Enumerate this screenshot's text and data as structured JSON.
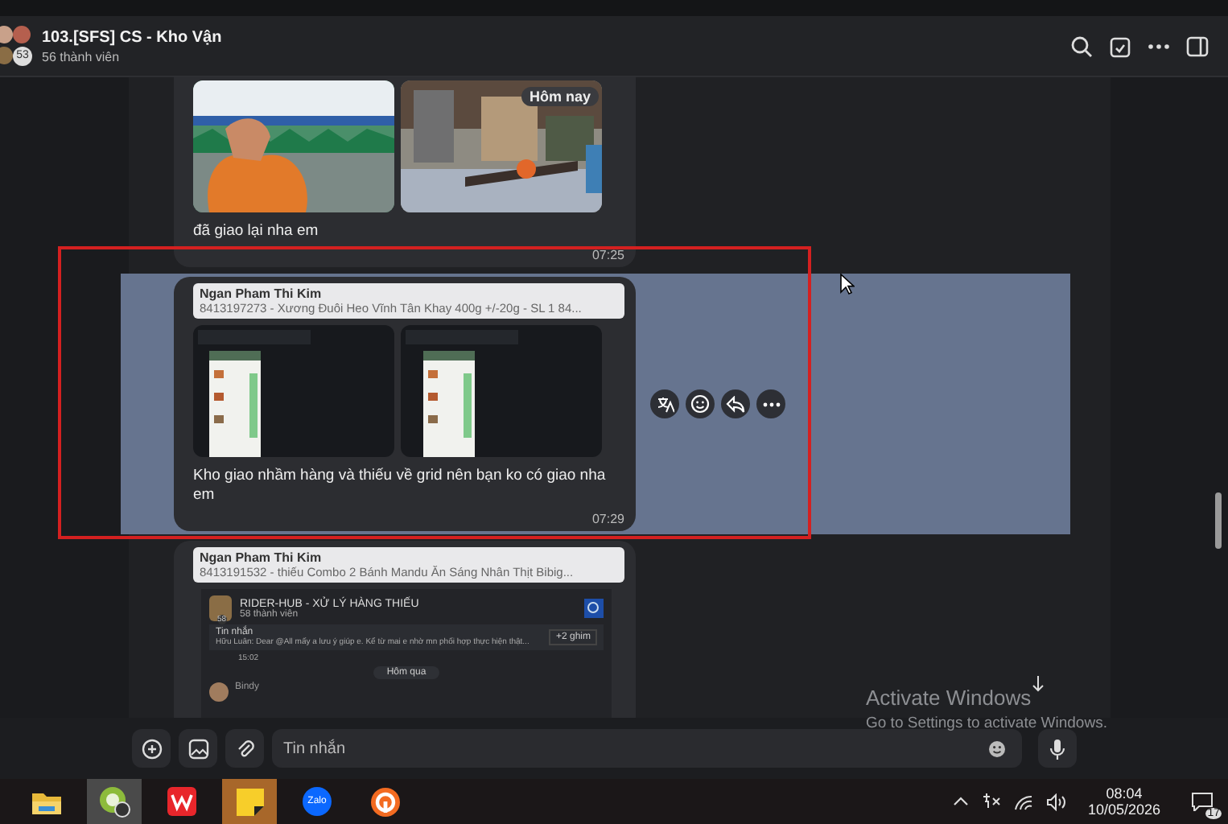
{
  "chat": {
    "title": "103.[SFS] CS - Kho Vận",
    "members": "56 thành viên",
    "avatar_count": "53"
  },
  "messages": [
    {
      "kind": "photos",
      "date_badge": "Hôm nay",
      "text": "đã giao lại nha em",
      "time": "07:25",
      "selected": false
    },
    {
      "kind": "screenshots",
      "quote_author": "Ngan Pham Thi Kim",
      "quote_text": "8413197273 - Xương Đuôi Heo Vĩnh Tân Khay 400g +/-20g - SL 1 84...",
      "text": "Kho giao nhầm hàng và thiếu về grid nên bạn ko có giao nha em",
      "time": "07:29",
      "selected": true
    },
    {
      "kind": "app_window",
      "quote_author": "Ngan Pham Thi Kim",
      "quote_text": "8413191532 - thiếu Combo 2 Bánh Mandu Ăn Sáng Nhân Thịt Bibig...",
      "window": {
        "title": "RIDER-HUB - XỬ LÝ HÀNG THIẾU",
        "members": "58 thành viên",
        "avatar_count": "58",
        "pin_label": "Tin nhắn",
        "pin_text": "Hữu Luân: Dear @All mấy a lưu ý giúp e. Kể từ mai e nhờ mn phối hợp thực hiện thật...",
        "pins": "+2 ghim",
        "time": "15:02",
        "date_badge": "Hôm qua",
        "sender": "Bindy"
      },
      "selected": false
    }
  ],
  "composer": {
    "placeholder": "Tin nhắn"
  },
  "watermark": {
    "title": "Activate Windows",
    "subtitle": "Go to Settings to activate Windows."
  },
  "taskbar": {
    "apps": [
      {
        "kind": "explorer",
        "highlighted": false
      },
      {
        "kind": "green",
        "highlighted": true
      },
      {
        "kind": "wps",
        "highlighted": false
      },
      {
        "kind": "notes",
        "highlighted": true
      },
      {
        "kind": "zalo",
        "label": "Zalo",
        "highlighted": false
      },
      {
        "kind": "vpn",
        "highlighted": false
      }
    ],
    "time": "08:04",
    "date": "10/05/2026",
    "notifications": "17"
  }
}
